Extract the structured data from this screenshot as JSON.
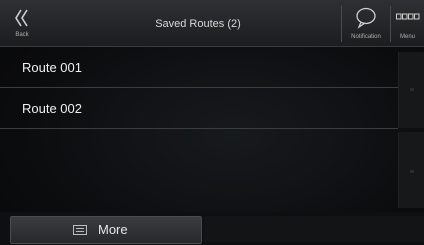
{
  "header": {
    "back_label": "Back",
    "title": "Saved Routes (2)",
    "notification_label": "Notification",
    "menu_label": "Menu"
  },
  "routes": [
    {
      "label": "Route 001"
    },
    {
      "label": "Route 002"
    }
  ],
  "footer": {
    "more_label": "More"
  }
}
